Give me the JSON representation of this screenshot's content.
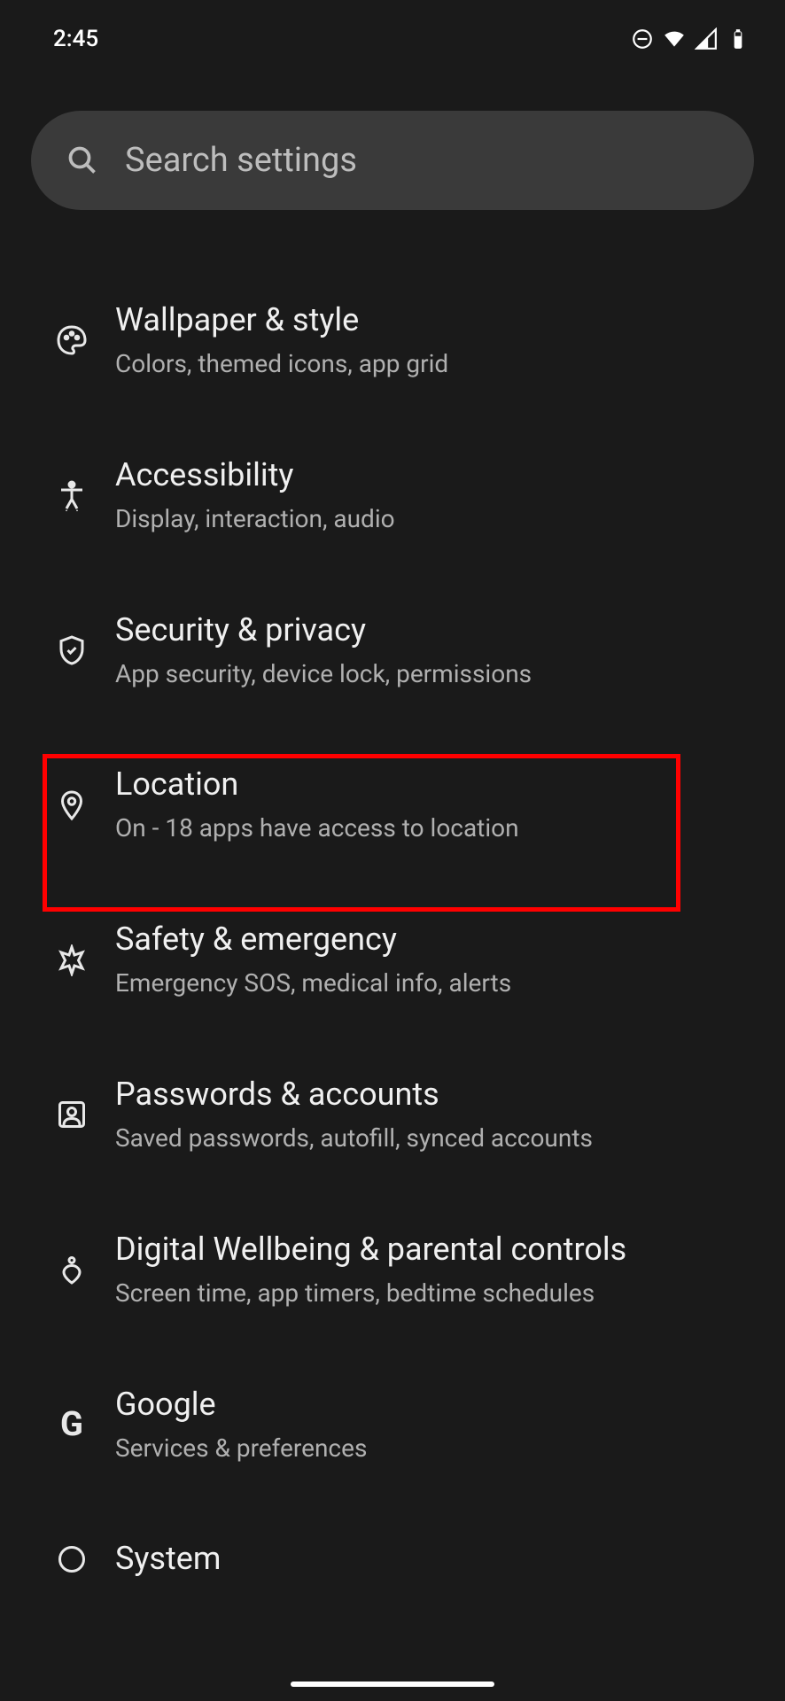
{
  "status": {
    "time": "2:45"
  },
  "search": {
    "placeholder": "Search settings"
  },
  "items": [
    {
      "title": "Wallpaper & style",
      "sub": "Colors, themed icons, app grid"
    },
    {
      "title": "Accessibility",
      "sub": "Display, interaction, audio"
    },
    {
      "title": "Security & privacy",
      "sub": "App security, device lock, permissions"
    },
    {
      "title": "Location",
      "sub": "On - 18 apps have access to location"
    },
    {
      "title": "Safety & emergency",
      "sub": "Emergency SOS, medical info, alerts"
    },
    {
      "title": "Passwords & accounts",
      "sub": "Saved passwords, autofill, synced accounts"
    },
    {
      "title": "Digital Wellbeing & parental controls",
      "sub": "Screen time, app timers, bedtime schedules"
    },
    {
      "title": "Google",
      "sub": "Services & preferences"
    },
    {
      "title": "System",
      "sub": ""
    }
  ]
}
